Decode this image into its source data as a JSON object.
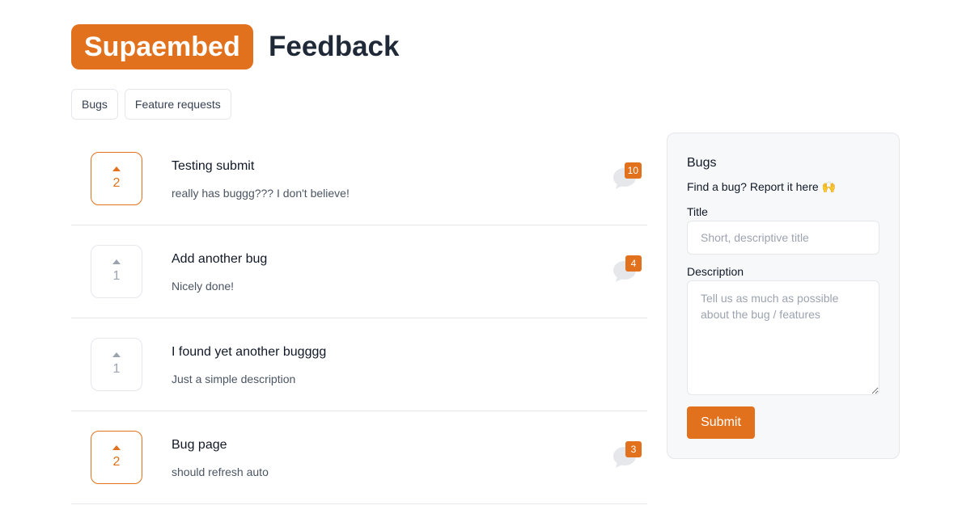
{
  "header": {
    "brand": "Supaembed",
    "title": "Feedback"
  },
  "tabs": [
    {
      "label": "Bugs"
    },
    {
      "label": "Feature requests"
    }
  ],
  "posts": [
    {
      "title": "Testing submit",
      "description": "really has buggg??? I don't believe!",
      "votes": "2",
      "voted": true,
      "comments": "10"
    },
    {
      "title": "Add another bug",
      "description": "Nicely done!",
      "votes": "1",
      "voted": false,
      "comments": "4"
    },
    {
      "title": "I found yet another bugggg",
      "description": "Just a simple description",
      "votes": "1",
      "voted": false,
      "comments": null
    },
    {
      "title": "Bug page",
      "description": "should refresh auto",
      "votes": "2",
      "voted": true,
      "comments": "3"
    }
  ],
  "panel": {
    "title": "Bugs",
    "subtitle": "Find a bug? Report it here 🙌",
    "title_label": "Title",
    "title_placeholder": "Short, descriptive title",
    "description_label": "Description",
    "description_placeholder": "Tell us as much as possible about the bug / features",
    "submit_label": "Submit"
  },
  "colors": {
    "accent": "#e2711d",
    "muted": "#9ca3af",
    "border": "#e5e7eb",
    "panel_bg": "#f7f8f9"
  },
  "icons": {
    "upvote": "triangle-up-icon",
    "comments": "comment-bubble-icon"
  }
}
